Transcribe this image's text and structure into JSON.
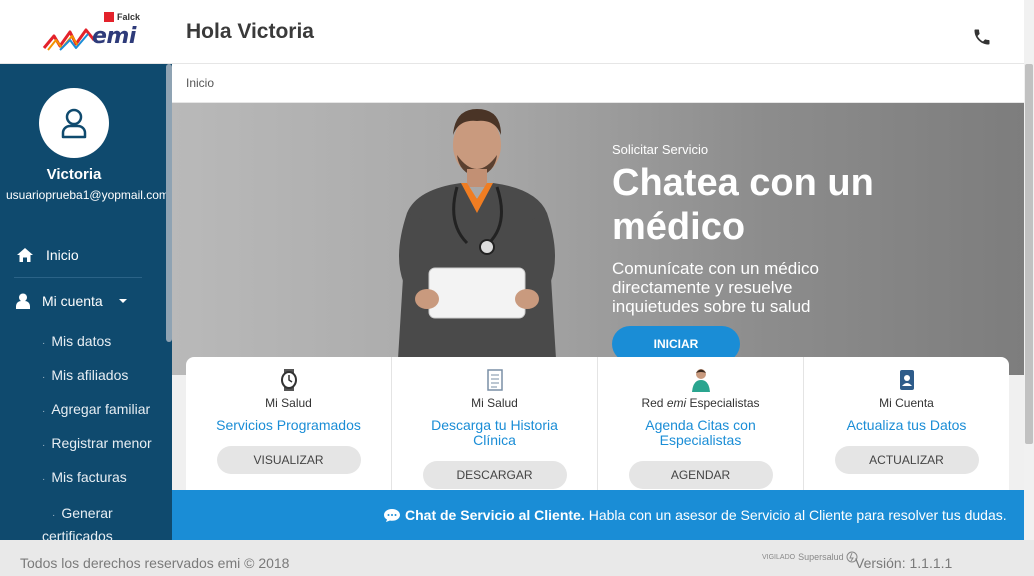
{
  "header": {
    "brand_parent": "Falck",
    "brand_name": "emi",
    "greeting": "Hola Victoria"
  },
  "sidebar": {
    "user_name": "Victoria",
    "user_email": "usuarioprueba1@yopmail.com",
    "nav": [
      {
        "label": "Inicio",
        "icon": "home-icon"
      },
      {
        "label": "Mi cuenta",
        "icon": "user-icon"
      }
    ],
    "sub_items": [
      "Mis datos",
      "Mis afiliados",
      "Agregar familiar",
      "Registrar menor",
      "Mis facturas",
      "Generar certificados"
    ]
  },
  "breadcrumb": {
    "current": "Inicio"
  },
  "hero": {
    "kicker": "Solicitar Servicio",
    "title": "Chatea con un médico",
    "description": "Comunícate con un médico directamente y resuelve inquietudes sobre tu salud",
    "button": "INICIAR"
  },
  "cards": [
    {
      "category": "Mi Salud",
      "title": "Servicios Programados",
      "button": "VISUALIZAR",
      "icon": "watch-icon"
    },
    {
      "category": "Mi Salud",
      "title": "Descarga tu Historia Clínica",
      "button": "DESCARGAR",
      "icon": "document-icon"
    },
    {
      "category_prefix": "Red ",
      "category_brand": "emi",
      "category_suffix": " Especialistas",
      "title": "Agenda Citas con Especialistas",
      "button": "AGENDAR",
      "icon": "specialist-icon"
    },
    {
      "category": "Mi Cuenta",
      "title": "Actualiza tus Datos",
      "button": "ACTUALIZAR",
      "icon": "id-card-icon"
    }
  ],
  "chat": {
    "bold": "Chat de Servicio al Cliente.",
    "text": "Habla con un asesor de Servicio al Cliente para resolver tus dudas."
  },
  "footer": {
    "copyright": "Todos los derechos reservados emi © 2018",
    "vigilado": "VIGILADO",
    "supersalud": "Supersalud",
    "version": "Versión: 1.1.1.1"
  },
  "colors": {
    "sidebar": "#0f4a6e",
    "accent": "#1a8dd6",
    "brand_red": "#e3222b"
  }
}
